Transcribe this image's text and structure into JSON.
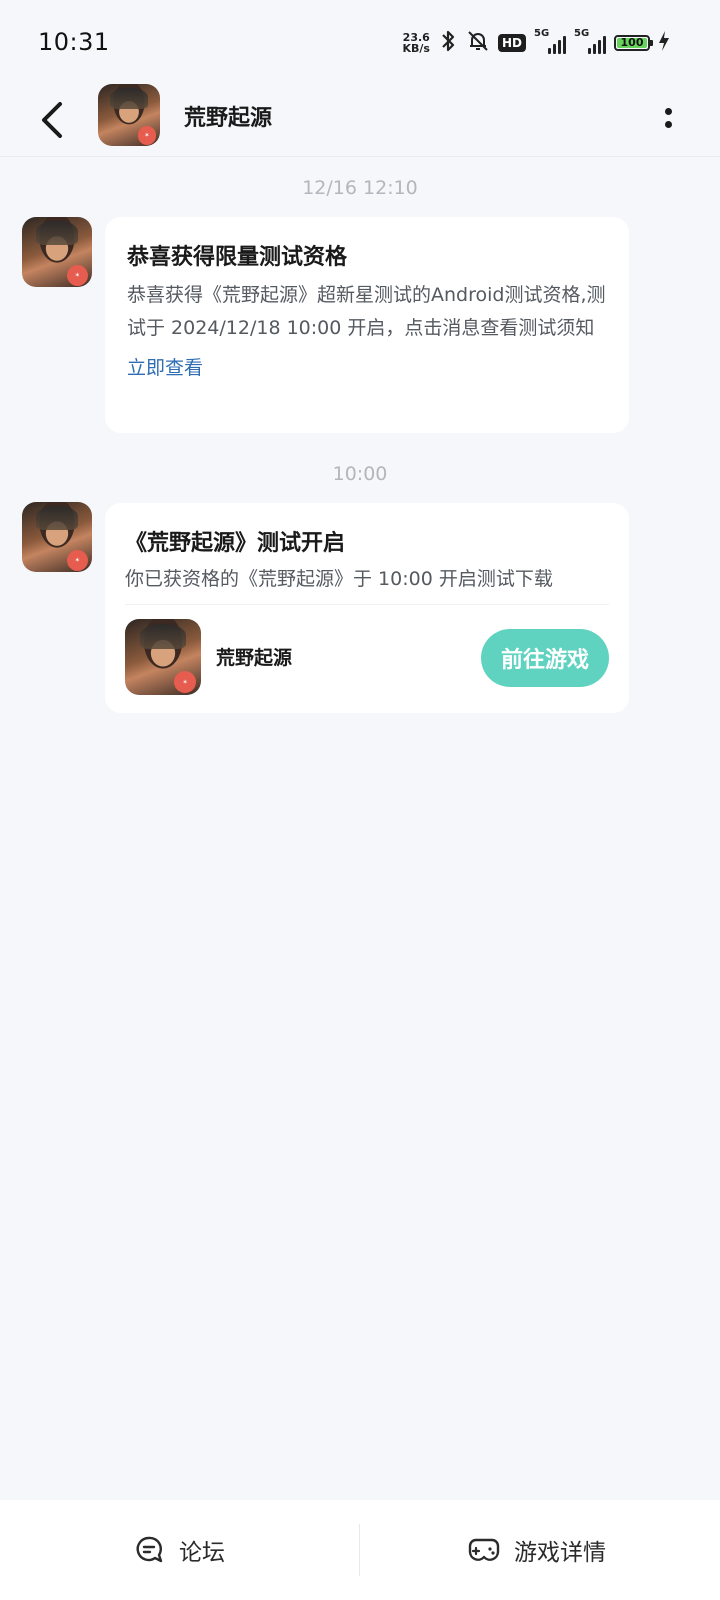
{
  "status_bar": {
    "time": "10:31",
    "net_speed_value": "23.6",
    "net_speed_unit": "KB/s",
    "hd_label": "HD",
    "signal1_label": "5G",
    "signal2_label": "5G",
    "battery": "100",
    "icons": [
      "bluetooth-icon",
      "mute-bell-icon",
      "hd-icon",
      "signal-icon",
      "battery-icon",
      "charging-icon"
    ]
  },
  "header": {
    "title": "荒野起源"
  },
  "messages": [
    {
      "timestamp": "12/16  12:10",
      "title": "恭喜获得限量测试资格",
      "body": "恭喜获得《荒野起源》超新星测试的Android测试资格,测试于 2024/12/18 10:00 开启，点击消息查看测试须知",
      "link": "立即查看"
    },
    {
      "timestamp": "10:00",
      "title": "《荒野起源》测试开启",
      "body": "你已获资格的《荒野起源》于 10:00 开启测试下载",
      "game_name": "荒野起源",
      "button": "前往游戏"
    }
  ],
  "bottom_bar": {
    "forum": "论坛",
    "details": "游戏详情"
  },
  "colors": {
    "background": "#f5f7fa",
    "accent_button": "#5fd3bf",
    "link": "#2f6db3",
    "timestamp": "#b3b6bc"
  }
}
